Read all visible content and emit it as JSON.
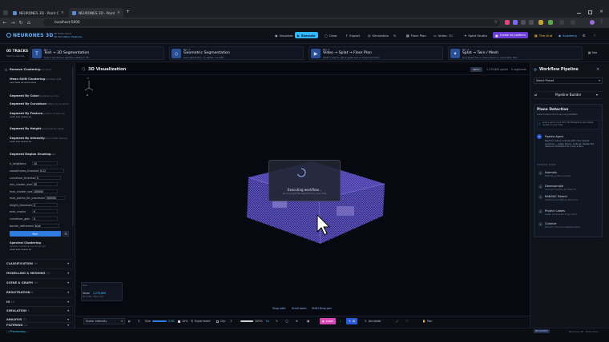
{
  "browser": {
    "tabs": [
      {
        "label": "NEURONES 3D - Point Cloud I",
        "active": false
      },
      {
        "label": "NEURONES 3D - Point Cloud I",
        "active": true
      }
    ],
    "url": "localhost:5000",
    "new_tab": "+"
  },
  "app": {
    "logo": "NEURONES 3D",
    "subtitle_top": "3D Point Cloud",
    "subtitle_bottom": "3D Simulation Pipelines",
    "nav": {
      "visualize": "Visualize",
      "execute": "Execute",
      "clear": "Clear",
      "export": "Export",
      "simulation": "Simulation",
      "floor_plan": "Floor Plan",
      "video": "Video",
      "video_count": "3D",
      "splat_studio": "Splat Studio",
      "create_platform": "Create 3d platform",
      "the_grid": "The Grid",
      "academy": "Academy"
    }
  },
  "tracks": {
    "count_label": "05 TRACKS",
    "count_sub": "Click to execute",
    "items": [
      {
        "no": "NO. 1",
        "title": "Text → 3D Segmentation",
        "desc": "type a sentence, get the masks in 3D",
        "icon": "text-icon"
      },
      {
        "no": "NO. 2",
        "title": "Geometric Segmentation",
        "desc": "Pure geometry, no labels, no GPU",
        "icon": "cube-icon"
      },
      {
        "no": "NO. 3",
        "title": "Video → Splat → Floor Plan",
        "desc": "Walk a space, get a splat and a measured plan",
        "icon": "video-icon"
      },
      {
        "no": "NO. 4",
        "title": "Splat → Twin / Mesh",
        "desc": "Any splat into a clean mesh or queryable twin",
        "icon": "splat-icon"
      }
    ],
    "see_all": "See"
  },
  "left_panel": {
    "items": [
      {
        "title": "Remove Clustering",
        "desc": "2 items active"
      },
      {
        "title": "Mean Shift Clustering",
        "desc": "Standard Mean Shift"
      },
      {
        "title": "Segment By Color",
        "desc": "Segmentation by color"
      },
      {
        "title": "Segment By Curvature",
        "desc": "Segmentation by curvature"
      },
      {
        "title": "Segment By Feature",
        "desc": "Segmentation by features"
      },
      {
        "title": "Segment By Height",
        "desc": "Segment points by height"
      },
      {
        "title": "Segment By Intensity",
        "desc": "Segment by LiDAR intensity"
      },
      {
        "title": "Segment Region Growing",
        "desc": "Full view"
      }
    ],
    "params": [
      {
        "label": "k_neighbors",
        "value": "10"
      },
      {
        "label": "smoothness_threshold",
        "value": "0.12"
      },
      {
        "label": "curvature_threshold",
        "value": "0"
      },
      {
        "label": "min_cluster_size",
        "value": "30"
      },
      {
        "label": "max_cluster_size",
        "value": "100000"
      },
      {
        "label": "max_points_for_processing",
        "value": "300000"
      },
      {
        "label": "height_threshold",
        "value": "0"
      },
      {
        "label": "max_cracks",
        "value": "0"
      },
      {
        "label": "curvature_gain",
        "value": "0"
      },
      {
        "label": "border_refinement",
        "value": "true"
      }
    ],
    "run_button": "Run",
    "spectral": {
      "title": "Spectral Clustering",
      "desc": "Spectral clustering of point groups"
    },
    "sections": [
      "CLASSIFICATION",
      "MODELLING & MESHING",
      "SCENE & GRAPH",
      "REGISTRATION",
      "IO",
      "SIMULATION",
      "ANALYSIS",
      "FILTERING"
    ],
    "section_counts": [
      "10",
      "10",
      "10",
      "6",
      "10",
      "5",
      "12",
      "15"
    ]
  },
  "viewport": {
    "title": "3D Visualization",
    "badge": "INPUT",
    "points": "1,275,890 points",
    "segments": "0 segments",
    "axis_y": "Y",
    "axis_z": "Z",
    "overlay_title": "Executing workflow...",
    "overlay_desc": "Running selected algorithms on your data",
    "legend_line1": "Live",
    "legend_label": "Value",
    "legend_value": "1,275,890",
    "legend_range": "Min 0.00 · Max 1.00",
    "nav_hints": [
      "Shap orbit",
      "Scroll zoom",
      "Shift+Drag pan"
    ],
    "toolbar": {
      "color_mode": "Scalar Intensity",
      "size_label": "Size",
      "size_value": "2.00",
      "grid_label": "Grid",
      "grid_value": "10%",
      "experiment": "Experiment",
      "clip_label": "Clip",
      "clip_value": "2",
      "zoom_value": "100%",
      "zoom_mark": "1x",
      "label_btn": "Label",
      "ai_btn": "AI",
      "annotate": "Annotate",
      "pan": "Pan"
    }
  },
  "workflow": {
    "title": "Workflow Pipeline",
    "select_placeholder": "Select Preset",
    "builder": "Pipeline Builder",
    "preset_title": "Plane Detection",
    "preset_desc": "Detect planar structures using RANSAC",
    "note": "Load a point cloud from 3D Datasets to get instant results on your data",
    "ai_name": "Pipeline Agent",
    "ai_text": "Best for indoor scenes with clear planar surfaces — walls, floors, ceilings. Tweak the distance threshold for noisy scans.",
    "steps_label": "PIPELINE STEPS",
    "steps": [
      {
        "n": "1",
        "title": "Normals",
        "desc": "Estimate surface normals"
      },
      {
        "n": "2",
        "title": "Downsample",
        "desc": "Voxel grid (0.05m) for faster fit"
      },
      {
        "n": "3",
        "title": "RANSAC Detect",
        "desc": "Iterative plane fitting, dist 0.02m"
      },
      {
        "n": "4",
        "title": "Project Labels",
        "desc": "Assign planes back to full cloud"
      },
      {
        "n": "5",
        "title": "Colorize",
        "desc": "Random colour per detected plane"
      }
    ]
  },
  "status": {
    "left": "Processing...",
    "right_badge": "NEURONES",
    "right_text": "Neurones 3D · Point Cloud"
  },
  "colors": {
    "accent": "#4c8dff",
    "cyan": "#42d3ff",
    "brand": "#62b5ff",
    "label": "#d946b5"
  }
}
